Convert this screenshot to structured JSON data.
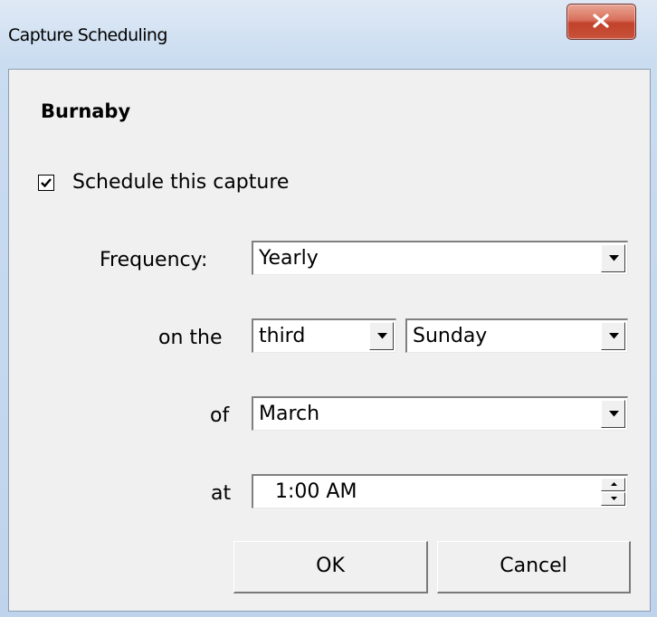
{
  "window": {
    "title": "Capture Scheduling"
  },
  "dialog": {
    "heading": "Burnaby",
    "schedule_checkbox": {
      "label": "Schedule this capture",
      "checked": true
    },
    "frequency": {
      "label": "Frequency:",
      "value": "Yearly"
    },
    "on_the": {
      "label": "on the",
      "ordinal_value": "third",
      "day_value": "Sunday"
    },
    "of": {
      "label": "of",
      "value": "March"
    },
    "at": {
      "label": "at",
      "value": "1:00 AM"
    },
    "buttons": {
      "ok": "OK",
      "cancel": "Cancel"
    }
  },
  "icons": {
    "close": "close-icon",
    "dropdown": "chevron-down-icon",
    "spin_up": "arrow-up-icon",
    "spin_down": "arrow-down-icon",
    "check": "checkmark-icon"
  }
}
